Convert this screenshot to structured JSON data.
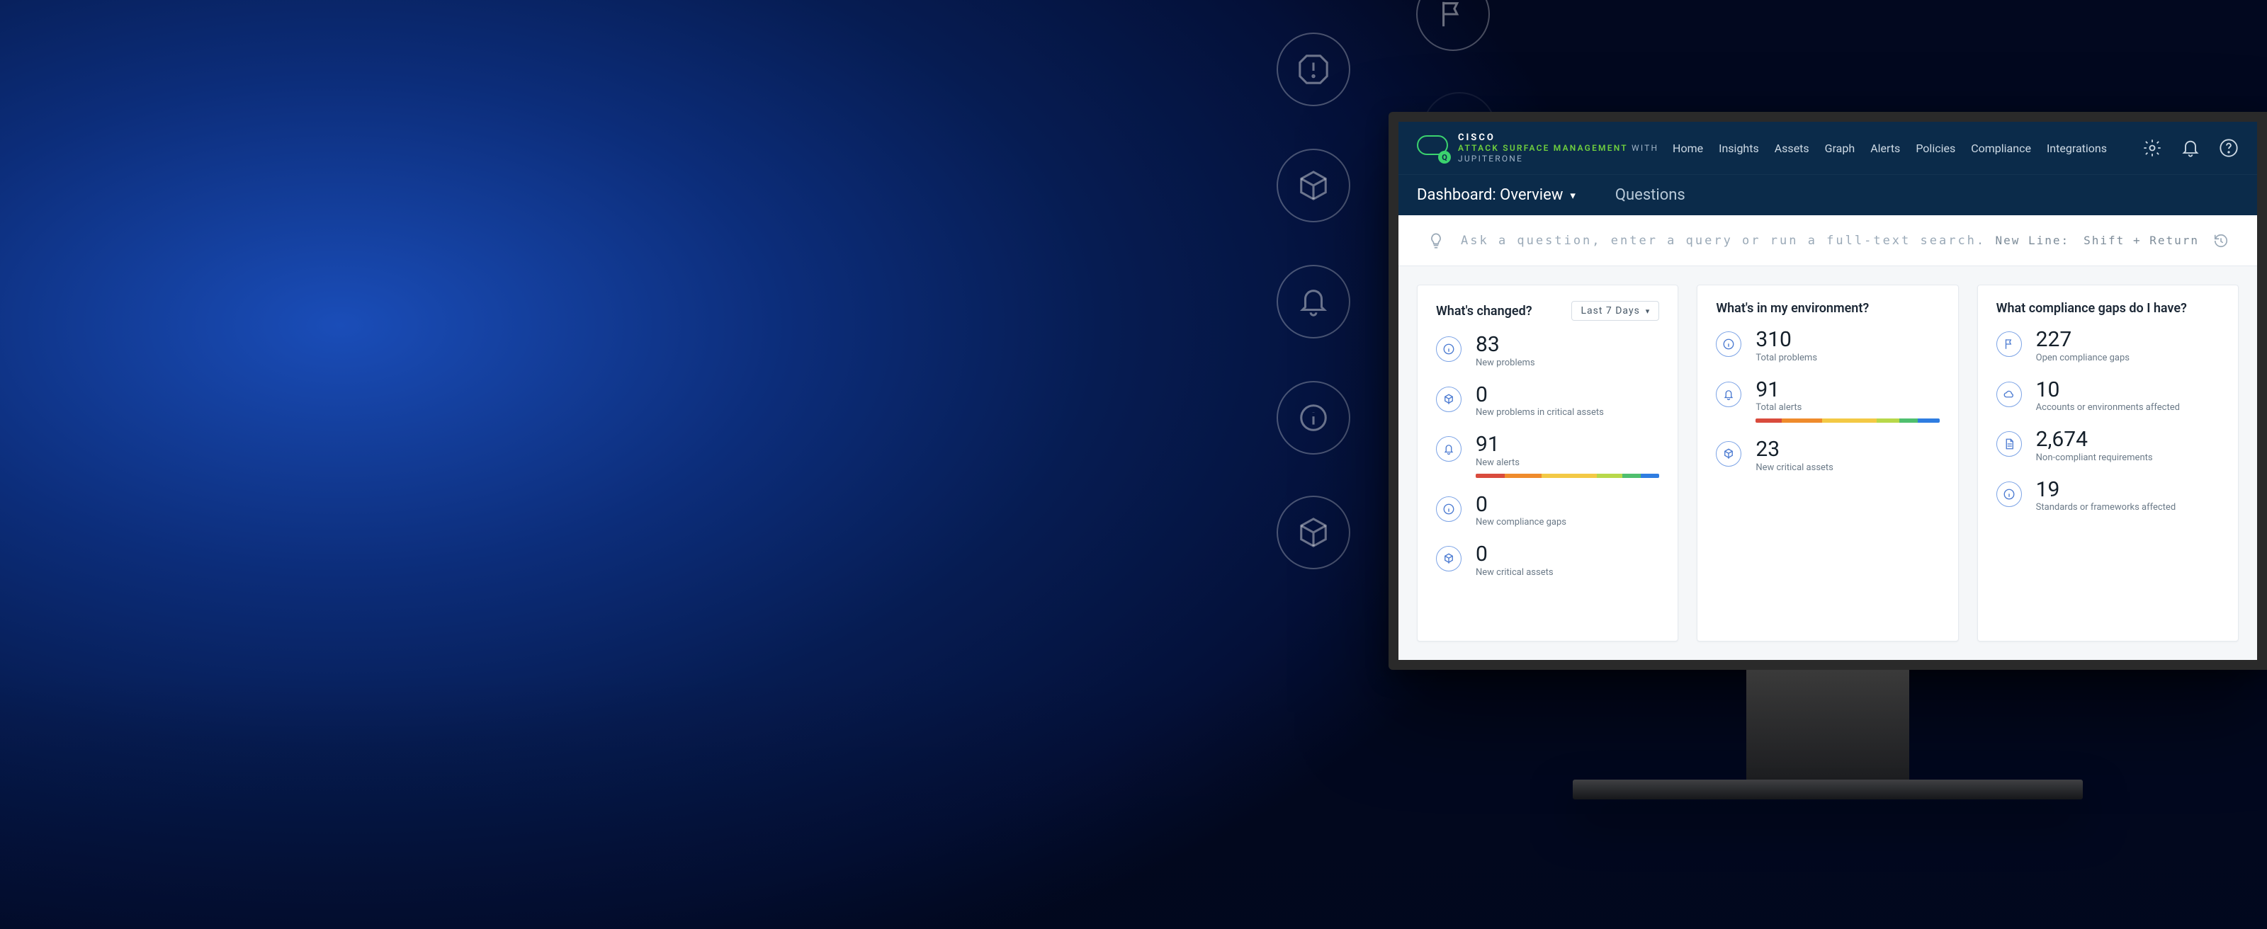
{
  "brand": {
    "top": "CISCO",
    "product": "ATTACK SURFACE MANAGEMENT",
    "with": "WITH JUPITERONE"
  },
  "nav": {
    "home": "Home",
    "insights": "Insights",
    "assets": "Assets",
    "graph": "Graph",
    "alerts": "Alerts",
    "policies": "Policies",
    "compliance": "Compliance",
    "integrations": "Integrations"
  },
  "tabs": {
    "dashboard": "Dashboard: Overview",
    "questions": "Questions"
  },
  "search": {
    "placeholder": "Ask a question, enter a query or run a full-text search.",
    "hint_label": "New Line:",
    "hint_keys": "Shift + Return"
  },
  "cards": {
    "changed": {
      "title": "What's changed?",
      "range": "Last 7 Days",
      "metrics": {
        "new_problems": {
          "value": "83",
          "label": "New problems"
        },
        "new_problems_critical": {
          "value": "0",
          "label": "New problems in critical assets"
        },
        "new_alerts": {
          "value": "91",
          "label": "New alerts"
        },
        "new_compliance_gaps": {
          "value": "0",
          "label": "New compliance gaps"
        },
        "new_critical_assets": {
          "value": "0",
          "label": "New critical assets"
        }
      }
    },
    "environment": {
      "title": "What's in my environment?",
      "metrics": {
        "total_problems": {
          "value": "310",
          "label": "Total problems"
        },
        "total_alerts": {
          "value": "91",
          "label": "Total alerts"
        },
        "new_critical_assets": {
          "value": "23",
          "label": "New critical assets"
        }
      }
    },
    "compliance": {
      "title": "What compliance gaps do I have?",
      "metrics": {
        "open_gaps": {
          "value": "227",
          "label": "Open compliance gaps"
        },
        "accounts_affected": {
          "value": "10",
          "label": "Accounts or environments affected"
        },
        "non_compliant_req": {
          "value": "2,674",
          "label": "Non-compliant requirements"
        },
        "standards_affected": {
          "value": "19",
          "label": "Standards or frameworks affected"
        }
      }
    }
  },
  "spark_colors": {
    "red": "#d94b3d",
    "orange": "#ef8b2c",
    "yellow": "#f3c945",
    "lime": "#b8d84a",
    "green": "#4fbf6e",
    "blue": "#2f7de1"
  }
}
